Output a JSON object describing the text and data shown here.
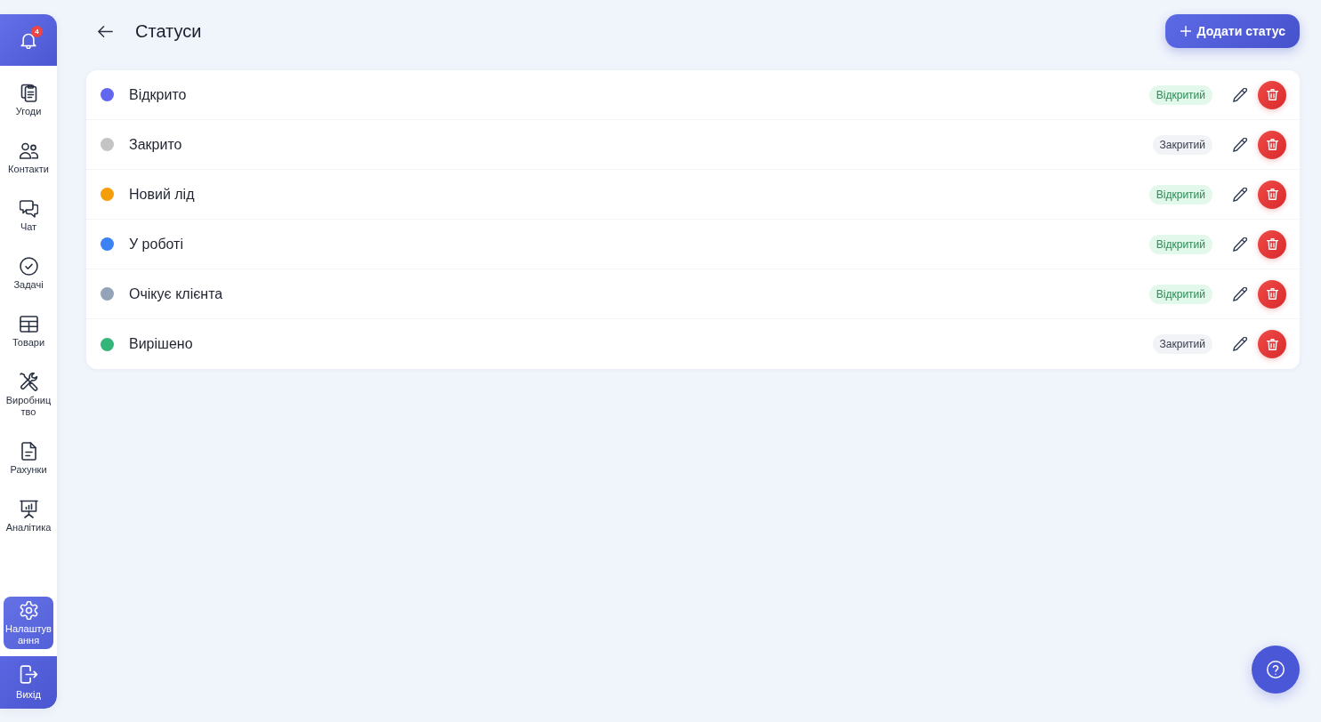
{
  "sidebar": {
    "notifications": {
      "count": "4"
    },
    "items": [
      {
        "label": "Угоди",
        "kind": "clipboards",
        "selected": false
      },
      {
        "label": "Контакти",
        "kind": "people",
        "selected": false
      },
      {
        "label": "Чат",
        "kind": "chat",
        "selected": false
      },
      {
        "label": "Задачі",
        "kind": "check",
        "selected": false
      },
      {
        "label": "Товари",
        "kind": "table",
        "selected": false
      },
      {
        "label": "Виробництво",
        "kind": "tools",
        "selected": false
      },
      {
        "label": "Рахунки",
        "kind": "document",
        "selected": false
      },
      {
        "label": "Аналітика",
        "kind": "presentation",
        "selected": false
      }
    ],
    "bottom_items": [
      {
        "label": "Налаштування",
        "kind": "gear",
        "selected": true
      }
    ],
    "logout": {
      "label": "Вихід"
    }
  },
  "header": {
    "title": "Статуси",
    "add_button": "Додати статус"
  },
  "statuses": [
    {
      "name": "Відкрито",
      "color": "#6366f1",
      "status_type": {
        "label": "Відкритий",
        "kind": "open"
      }
    },
    {
      "name": "Закрито",
      "color": "#c4c4c4",
      "status_type": {
        "label": "Закритий",
        "kind": "closed"
      }
    },
    {
      "name": "Новий лід",
      "color": "#f59e0b",
      "status_type": {
        "label": "Відкритий",
        "kind": "open"
      }
    },
    {
      "name": "У роботі",
      "color": "#3b82f6",
      "status_type": {
        "label": "Відкритий",
        "kind": "open"
      }
    },
    {
      "name": "Очікує клієнта",
      "color": "#94a3b8",
      "status_type": {
        "label": "Відкритий",
        "kind": "open"
      }
    },
    {
      "name": "Вирішено",
      "color": "#34b67a",
      "status_type": {
        "label": "Закритий",
        "kind": "closed"
      }
    }
  ]
}
